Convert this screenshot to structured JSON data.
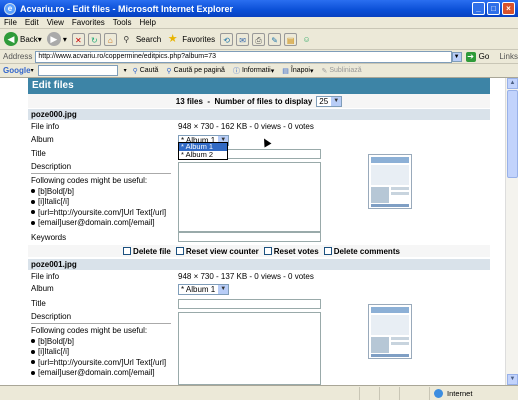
{
  "window": {
    "title": "Acvariu.ro - Edit files - Microsoft Internet Explorer"
  },
  "menu": [
    "File",
    "Edit",
    "View",
    "Favorites",
    "Tools",
    "Help"
  ],
  "toolbar": {
    "back": "Back",
    "search": "Search",
    "favorites": "Favorites"
  },
  "address": {
    "label": "Address",
    "url": "http://www.acvariu.ro/coppermine/editpics.php?album=73",
    "go": "Go",
    "links": "Links"
  },
  "google": {
    "logo": "Google",
    "cauta": "Caută",
    "cauta_pagina": "Caută pe pagină",
    "informatii": "Informatii",
    "inapoi": "Înapoi",
    "subliniaza": "Subliniază"
  },
  "page": {
    "header": "Edit files",
    "count_label": "13 files",
    "separator": "-",
    "display_label": "Number of files to display",
    "display_value": "25",
    "files": [
      {
        "name": "poze000.jpg",
        "info_label": "File info",
        "info": "948 × 730 - 162 KB - 0 views - 0 votes",
        "album_label": "Album",
        "album_value": "* Album 1",
        "title_label": "Title",
        "desc_label": "Description",
        "keywords_label": "Keywords"
      },
      {
        "name": "poze001.jpg",
        "info_label": "File info",
        "info": "948 × 730 - 137 KB - 0 views - 0 votes",
        "album_label": "Album",
        "album_value": "* Album 1",
        "title_label": "Title",
        "desc_label": "Description"
      }
    ],
    "codes_intro": "Following codes might be useful:",
    "codes": [
      "[b]Bold[/b]",
      "[i]Italic[/i]",
      "[url=http://yoursite.com/]Url Text[/url]",
      "[email]user@domain.com[/email]"
    ],
    "checks": [
      "Delete file",
      "Reset view counter",
      "Reset votes",
      "Delete comments"
    ],
    "album_options": [
      "* Album 1",
      "* Album 2"
    ]
  },
  "status": {
    "zone": "Internet"
  }
}
